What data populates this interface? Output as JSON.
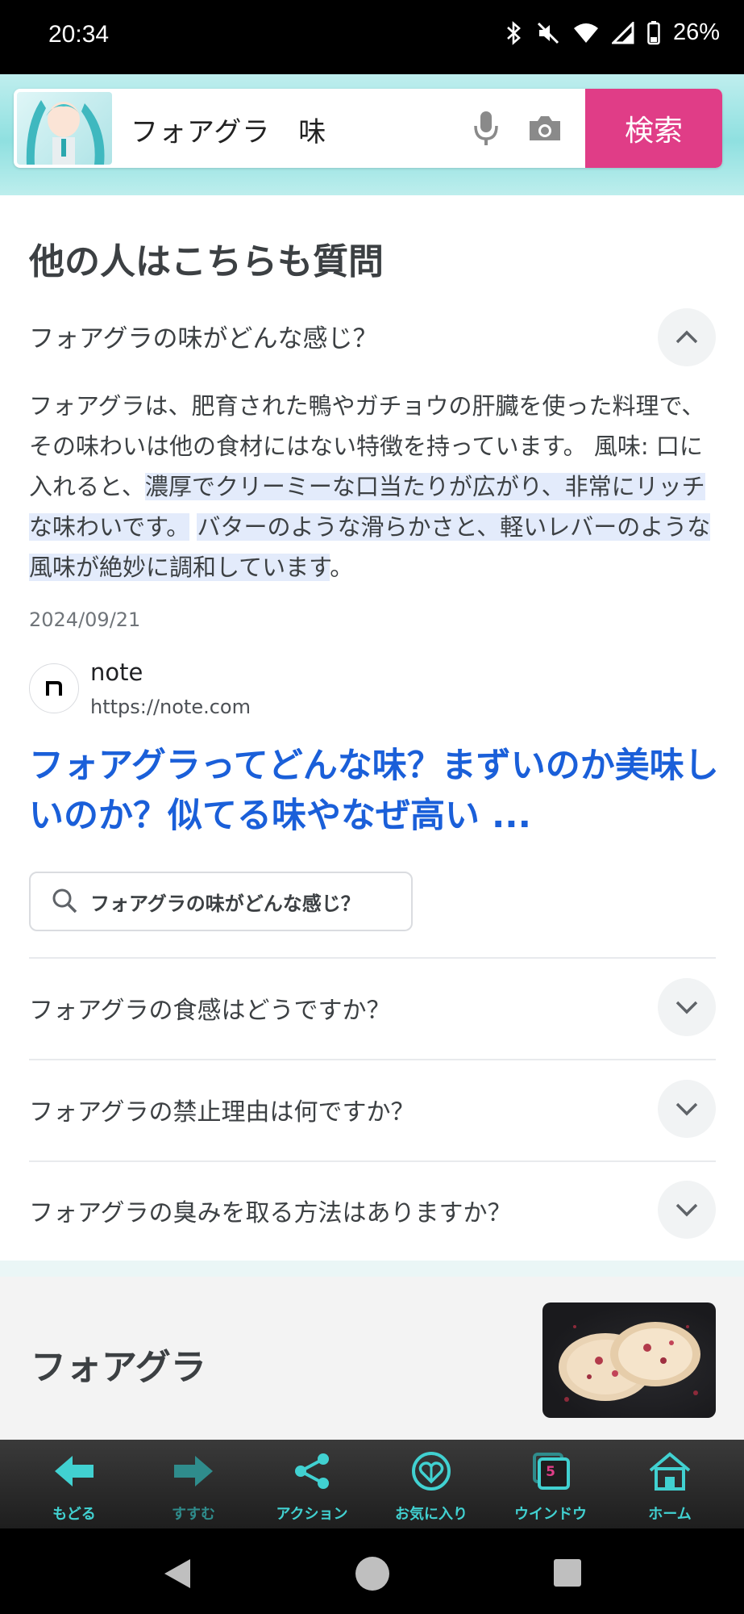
{
  "status_bar": {
    "time": "20:34",
    "battery": "26%"
  },
  "search": {
    "query": "フォアグラ　味",
    "button_label": "検索"
  },
  "paa": {
    "heading": "他の人はこちらも質問",
    "open_question": "フォアグラの味がどんな感じ？",
    "answer_plain": "フォアグラは、肥育された鴨やガチョウの肝臓を使った料理で、その味わいは他の食材にはない特徴を持っています。 風味: 口に入れると、",
    "answer_highlight1": "濃厚でクリーミーな口当たりが広がり、非常にリッチな味わいです。",
    "answer_highlight2": "バターのような滑らかさと、軽いレバーのような風味が絶妙に調和しています",
    "answer_end": "。",
    "date": "2024/09/21",
    "source_name": "note",
    "source_url": "https://note.com",
    "result_link": "フォアグラってどんな味？まずいのか美味しいのか？似てる味やなぜ高い ...",
    "search_pill": "フォアグラの味がどんな感じ？",
    "questions": [
      "フォアグラの食感はどうですか？",
      "フォアグラの禁止理由は何ですか？",
      "フォアグラの臭みを取る方法はありますか？"
    ]
  },
  "knowledge_panel": {
    "title": "フォアグラ"
  },
  "toolbar": {
    "back": "もどる",
    "forward": "すすむ",
    "action": "アクション",
    "favorites": "お気に入り",
    "windows": "ウインドウ",
    "window_count": "5",
    "home": "ホーム"
  },
  "colors": {
    "accent": "#e03d87",
    "link": "#1a5fd9",
    "toolbar_text": "#41d1d1"
  }
}
